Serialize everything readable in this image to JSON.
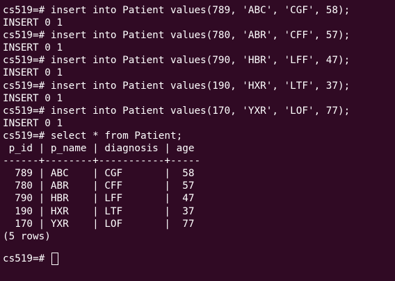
{
  "terminal": {
    "lines": [
      "cs519=# insert into Patient values(789, 'ABC', 'CGF', 58);",
      "INSERT 0 1",
      "cs519=# insert into Patient values(780, 'ABR', 'CFF', 57);",
      "INSERT 0 1",
      "cs519=# insert into Patient values(790, 'HBR', 'LFF', 47);",
      "INSERT 0 1",
      "cs519=# insert into Patient values(190, 'HXR', 'LTF', 37);",
      "INSERT 0 1",
      "cs519=# insert into Patient values(170, 'YXR', 'LOF', 77);",
      "INSERT 0 1",
      "cs519=# select * from Patient;",
      " p_id | p_name | diagnosis | age ",
      "------+--------+-----------+-----",
      "  789 | ABC    | CGF       |  58",
      "  780 | ABR    | CFF       |  57",
      "  790 | HBR    | LFF       |  47",
      "  190 | HXR    | LTF       |  37",
      "  170 | YXR    | LOF       |  77",
      "(5 rows)"
    ],
    "prompt": "cs519=# ",
    "query_result": {
      "columns": [
        "p_id",
        "p_name",
        "diagnosis",
        "age"
      ],
      "rows": [
        [
          "789",
          "ABC",
          "CGF",
          "58"
        ],
        [
          "780",
          "ABR",
          "CFF",
          "57"
        ],
        [
          "790",
          "HBR",
          "LFF",
          "47"
        ],
        [
          "190",
          "HXR",
          "LTF",
          "37"
        ],
        [
          "170",
          "YXR",
          "LOF",
          "77"
        ]
      ],
      "row_count": "(5 rows)"
    },
    "colors": {
      "background": "#300a24",
      "foreground": "#ffffff"
    }
  }
}
